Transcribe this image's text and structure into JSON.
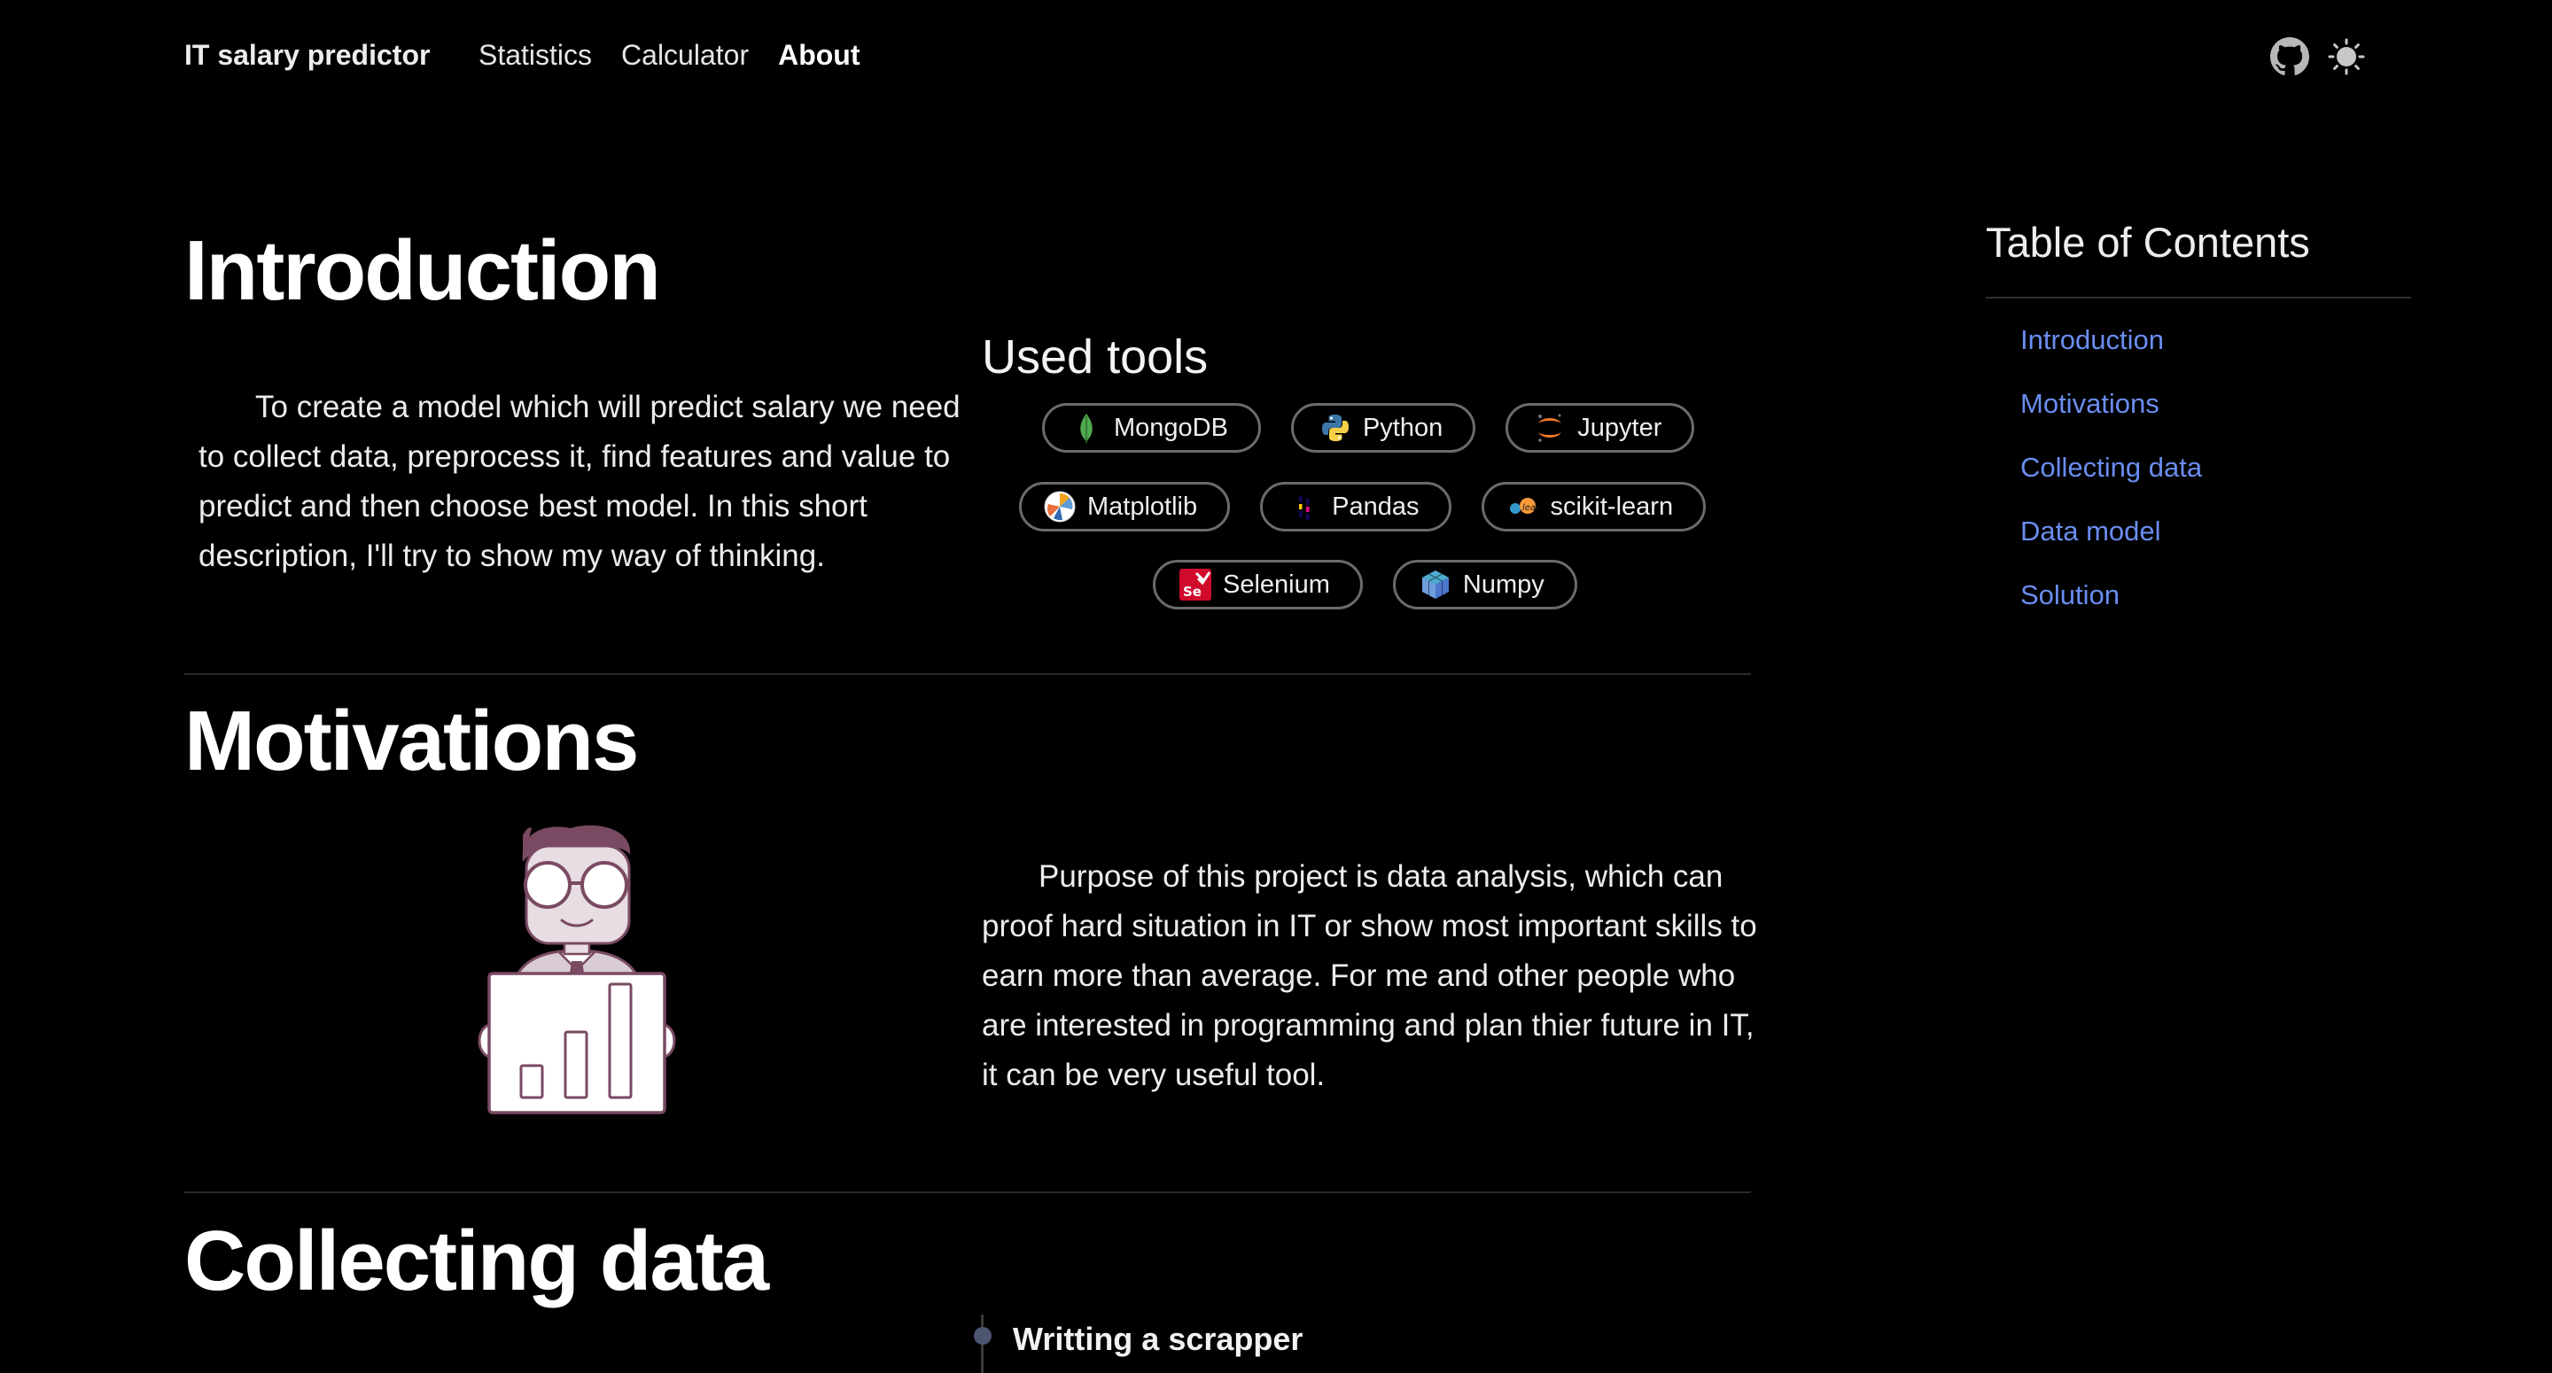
{
  "header": {
    "brand": "IT salary predictor",
    "nav": [
      "Statistics",
      "Calculator",
      "About"
    ],
    "active_nav": "About",
    "icons": [
      "github-icon",
      "theme-toggle-icon"
    ]
  },
  "intro": {
    "title": "Introduction",
    "text": "To create a model which will predict salary we need to collect data, preprocess it, find features and value to predict and then choose best model. In this short description, I'll try to show my way of thinking.",
    "tools_title": "Used tools",
    "tools": [
      [
        "MongoDB",
        "Python",
        "Jupyter"
      ],
      [
        "Matplotlib",
        "Pandas",
        "scikit-learn"
      ],
      [
        "Selenium",
        "Numpy"
      ]
    ]
  },
  "motivations": {
    "title": "Motivations",
    "illustration": "person-with-bar-chart-illustration",
    "text": "Purpose of this project is data analysis, which can proof hard situation in IT or show most important skills to earn more than average. For me and other people who are interested in programming and plan thier future in IT, it can be very useful tool."
  },
  "collecting": {
    "title": "Collecting data",
    "timeline": [
      "Writting a scrapper"
    ]
  },
  "toc": {
    "title": "Table of Contents",
    "items": [
      "Introduction",
      "Motivations",
      "Collecting data",
      "Data model",
      "Solution"
    ]
  },
  "colors": {
    "background": "#000000",
    "text": "#ededed",
    "link": "#6b8df0",
    "chip_border": "#6b6b6b",
    "illustration_accent": "#7a4a63"
  }
}
